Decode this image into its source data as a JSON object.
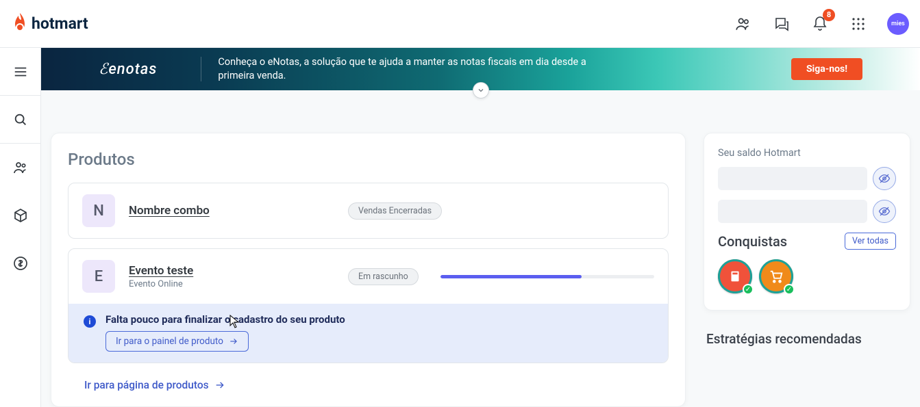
{
  "header": {
    "logo_text": "hotmart",
    "notification_count": "8",
    "avatar_text": "mies"
  },
  "banner": {
    "logo_text": "enotas",
    "text": "Conheça o eNotas, a solução que te ajuda a manter as notas fiscais em dia desde a primeira venda.",
    "button": "Siga-nos!"
  },
  "produtos": {
    "title": "Produtos",
    "items": [
      {
        "letter": "N",
        "name": "Nombre combo",
        "subtitle": "",
        "status": "Vendas Encerradas",
        "progress": 0
      },
      {
        "letter": "E",
        "name": "Evento teste",
        "subtitle": "Evento Online",
        "status": "Em rascunho",
        "progress": 66
      }
    ],
    "alert_text": "Falta pouco para finalizar o cadastro do seu produto",
    "alert_button": "Ir para o painel de produto",
    "page_link": "Ir para página de produtos"
  },
  "saldo": {
    "label": "Seu saldo Hotmart",
    "conquistas_title": "Conquistas",
    "ver_todas": "Ver todas"
  },
  "estrategias": {
    "title": "Estratégias recomendadas"
  }
}
